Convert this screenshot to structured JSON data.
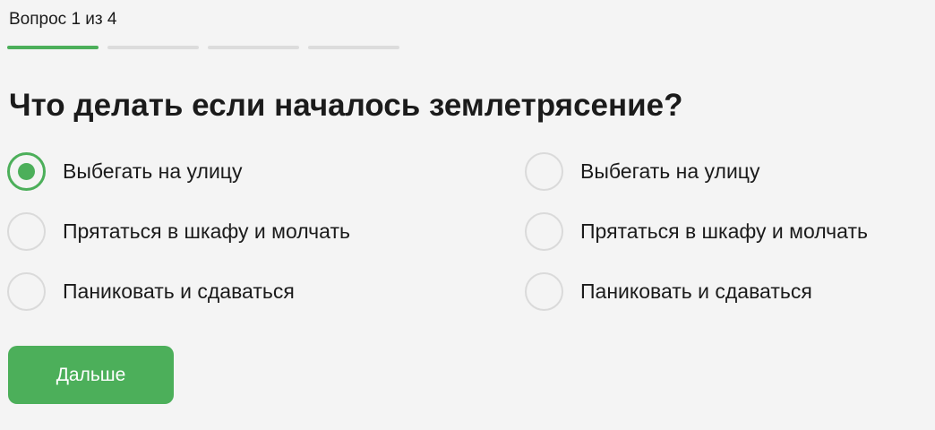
{
  "progress": {
    "label": "Вопрос 1 из 4",
    "current": 1,
    "total": 4
  },
  "question": {
    "title": "Что делать если началось землетрясение?"
  },
  "options": [
    {
      "label": "Выбегать на улицу",
      "selected": true
    },
    {
      "label": "Выбегать на улицу",
      "selected": false
    },
    {
      "label": "Прятаться в шкафу и молчать",
      "selected": false
    },
    {
      "label": "Прятаться в шкафу и молчать",
      "selected": false
    },
    {
      "label": "Паниковать и сдаваться",
      "selected": false
    },
    {
      "label": "Паниковать и сдаваться",
      "selected": false
    }
  ],
  "actions": {
    "next_label": "Дальше"
  },
  "colors": {
    "accent": "#4caf5a",
    "radio_border": "#dadada",
    "progress_track": "#dcdcdc",
    "background": "#f4f4f4",
    "text": "#1b1b1b"
  }
}
